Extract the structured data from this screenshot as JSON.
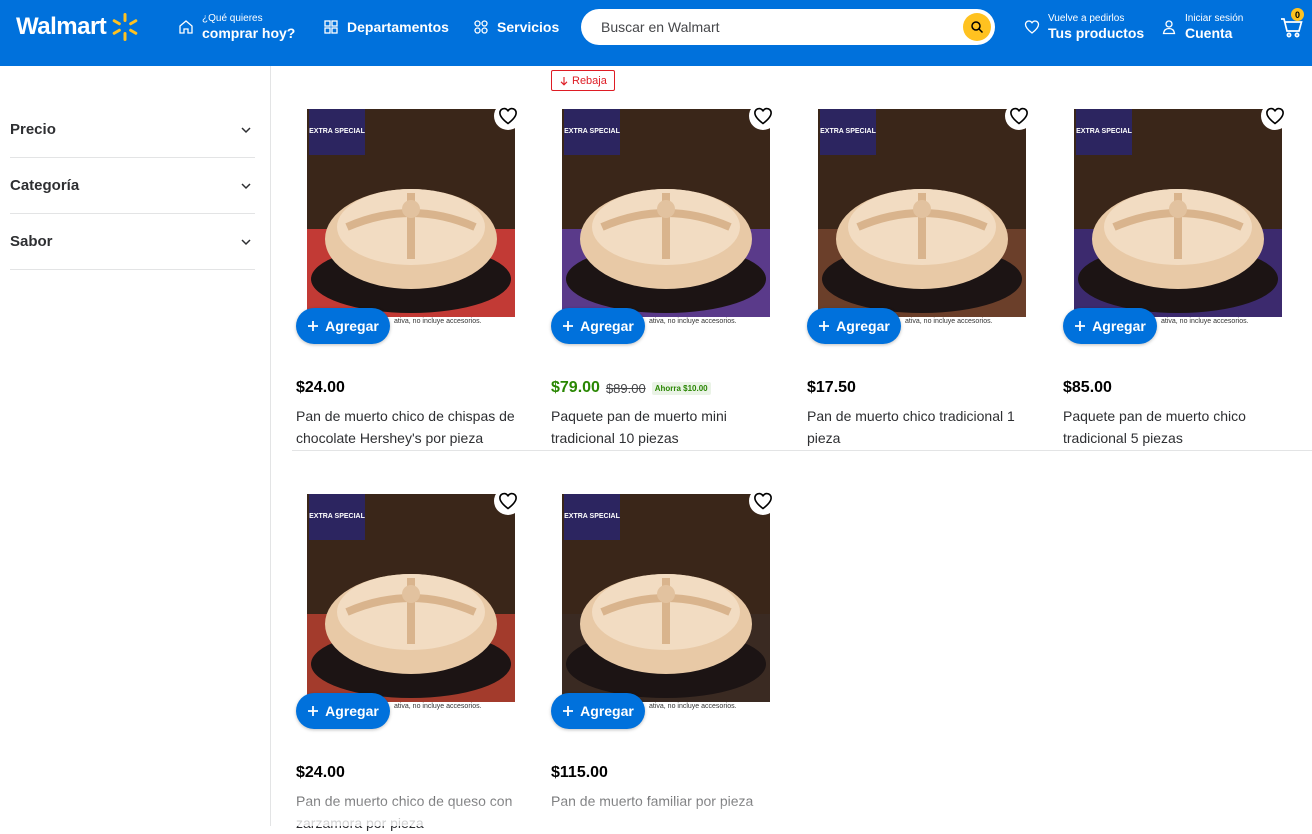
{
  "header": {
    "logo_text": "Walmart",
    "nav_shop": {
      "small": "¿Qué quieres",
      "big": "comprar hoy?"
    },
    "departments": "Departamentos",
    "services": "Servicios",
    "search_placeholder": "Buscar en Walmart",
    "reorder": {
      "small": "Vuelve a pedirlos",
      "big": "Tus productos"
    },
    "account": {
      "small": "Iniciar sesión",
      "big": "Cuenta"
    },
    "cart_count": "0",
    "brand_color": "#0071dc",
    "accent_color": "#ffc220"
  },
  "sidebar": {
    "filters": [
      {
        "label": "Precio"
      },
      {
        "label": "Categoría"
      },
      {
        "label": "Sabor"
      }
    ]
  },
  "rebaja_label": "Rebaja",
  "add_label": "Agregar",
  "image_badge": "EXTRA SPECIAL",
  "image_disclaimer": "ativa, no incluye accesorios.",
  "products": [
    {
      "price": "$24.00",
      "title": "Pan de muerto chico de chispas de chocolate Hershey's por pieza"
    },
    {
      "price": "$79.00",
      "old_price": "$89.00",
      "savings": "Ahorra $10.00",
      "title": "Paquete pan de muerto mini tradicional 10 piezas"
    },
    {
      "price": "$17.50",
      "title": "Pan de muerto chico tradicional 1 pieza"
    },
    {
      "price": "$85.00",
      "title": "Paquete pan de muerto chico tradicional 5 piezas"
    },
    {
      "price": "$24.00",
      "title": "Pan de muerto chico de queso con zarzamora por pieza"
    },
    {
      "price": "$115.00",
      "title": "Pan de muerto familiar por pieza"
    }
  ]
}
